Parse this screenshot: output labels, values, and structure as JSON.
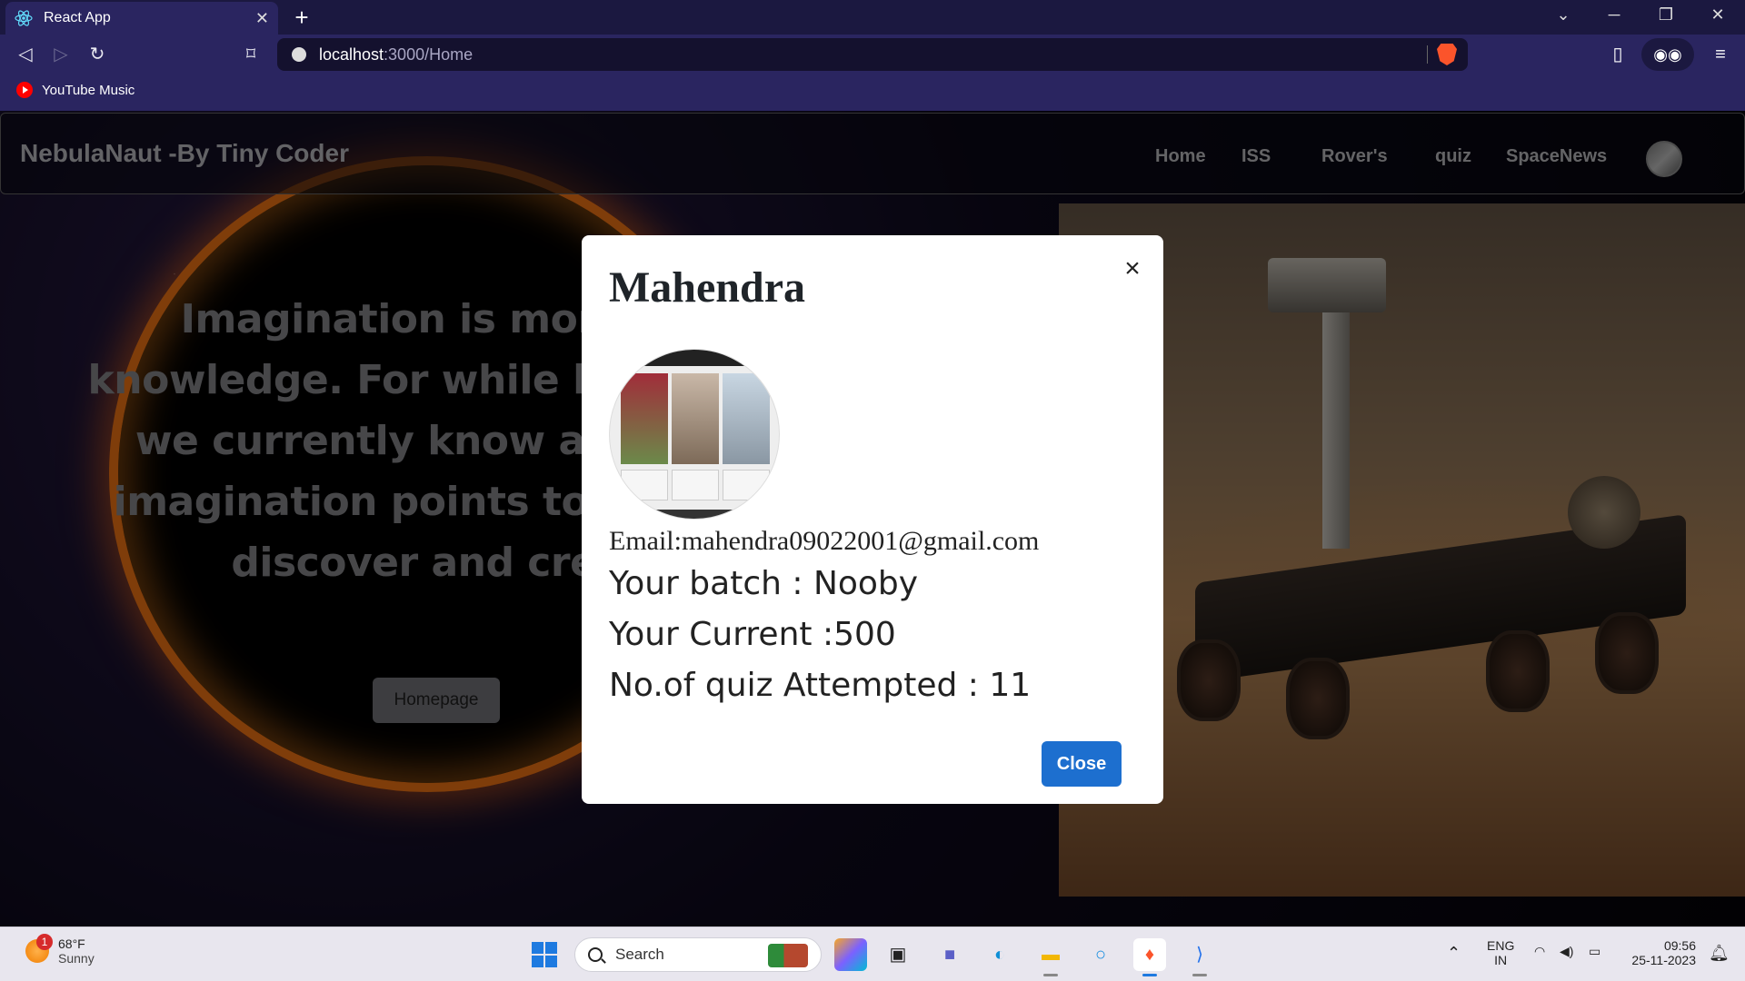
{
  "browser": {
    "tab_title": "React App",
    "tab_close": "✕",
    "new_tab": "+",
    "url_host": "localhost",
    "url_path": ":3000/Home",
    "bookmark_label": "YouTube Music"
  },
  "navbar": {
    "brand": "NebulaNaut -By Tiny Coder",
    "links": [
      "Home",
      "ISS",
      "Rover's",
      "quiz",
      "SpaceNews"
    ]
  },
  "hero": {
    "quote_lines": [
      "Imagination is more impo",
      "knowledge. For while knowle",
      "we currently know and u",
      "imagination points to all w",
      "discover and crea"
    ],
    "homepage_button": "Homepage"
  },
  "modal": {
    "title": "Mahendra",
    "close_x": "×",
    "email": "Email:mahendra09022001@gmail.com",
    "batch": "Your batch : Nooby",
    "current": "Your Current :500",
    "quiz_attempted": "No.of quiz Attempted : 11",
    "close_button": "Close"
  },
  "taskbar": {
    "weather_badge": "1",
    "weather_temp": "68°F",
    "weather_cond": "Sunny",
    "search_label": "Search",
    "lang_top": "ENG",
    "lang_bottom": "IN",
    "time": "09:56",
    "date": "25-11-2023"
  },
  "colors": {
    "accent": "#1d6fcf",
    "browser_bg": "#2a2560",
    "ring": "#ff7a14"
  }
}
